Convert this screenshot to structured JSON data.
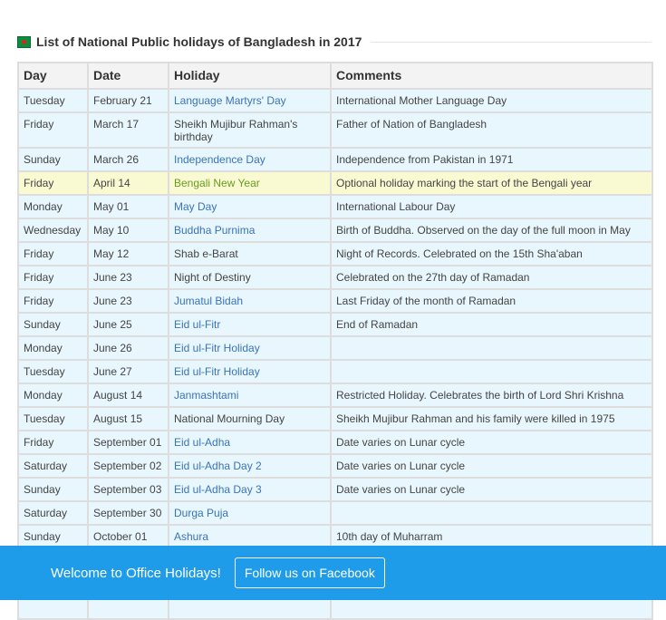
{
  "title": "List of National Public holidays of Bangladesh in 2017",
  "colors": {
    "link": "#3b73b9",
    "highlight_row": "#fafad2",
    "row_bg": "#e8f6fd",
    "banner": "#1e9be9"
  },
  "table": {
    "headers": [
      "Day",
      "Date",
      "Holiday",
      "Comments"
    ],
    "rows": [
      {
        "day": "Tuesday",
        "date": "February 21",
        "holiday": "Language Martyrs' Day",
        "link": true,
        "comment": "International Mother Language Day"
      },
      {
        "day": "Friday",
        "date": "March 17",
        "holiday": "Sheikh Mujibur Rahman's birthday",
        "link": false,
        "comment": "Father of Nation of Bangladesh"
      },
      {
        "day": "Sunday",
        "date": "March 26",
        "holiday": "Independence Day",
        "link": true,
        "comment": "Independence from Pakistan in 1971"
      },
      {
        "day": "Friday",
        "date": "April 14",
        "holiday": "Bengali New Year",
        "link": true,
        "highlight": true,
        "comment": "Optional holiday marking the start of the Bengali year"
      },
      {
        "day": "Monday",
        "date": "May 01",
        "holiday": "May Day",
        "link": true,
        "comment": "International Labour Day"
      },
      {
        "day": "Wednesday",
        "date": "May 10",
        "holiday": "Buddha Purnima",
        "link": true,
        "comment": "Birth of Buddha. Observed on the day of the full moon in May"
      },
      {
        "day": "Friday",
        "date": "May 12",
        "holiday": "Shab e-Barat",
        "link": false,
        "comment": "Night of Records. Celebrated on the 15th Sha'aban"
      },
      {
        "day": "Friday",
        "date": "June 23",
        "holiday": "Night of Destiny",
        "link": false,
        "comment": "Celebrated on the 27th day of Ramadan"
      },
      {
        "day": "Friday",
        "date": "June 23",
        "holiday": "Jumatul Bidah",
        "link": true,
        "comment": "Last Friday of the month of Ramadan"
      },
      {
        "day": "Sunday",
        "date": "June 25",
        "holiday": "Eid ul-Fitr",
        "link": true,
        "comment": "End of Ramadan"
      },
      {
        "day": "Monday",
        "date": "June 26",
        "holiday": "Eid ul-Fitr Holiday",
        "link": true,
        "comment": ""
      },
      {
        "day": "Tuesday",
        "date": "June 27",
        "holiday": "Eid ul-Fitr Holiday",
        "link": true,
        "comment": ""
      },
      {
        "day": "Monday",
        "date": "August 14",
        "holiday": "Janmashtami",
        "link": true,
        "comment": "Restricted Holiday. Celebrates the birth of Lord Shri Krishna"
      },
      {
        "day": "Tuesday",
        "date": "August 15",
        "holiday": "National Mourning Day",
        "link": false,
        "comment": "Sheikh Mujibur Rahman and his family were killed in 1975"
      },
      {
        "day": "Friday",
        "date": "September 01",
        "holiday": "Eid ul-Adha",
        "link": true,
        "comment": "Date varies on Lunar cycle"
      },
      {
        "day": "Saturday",
        "date": "September 02",
        "holiday": "Eid ul-Adha Day 2",
        "link": true,
        "comment": "Date varies on Lunar cycle"
      },
      {
        "day": "Sunday",
        "date": "September 03",
        "holiday": "Eid ul-Adha Day 3",
        "link": true,
        "comment": "Date varies on Lunar cycle"
      },
      {
        "day": "Saturday",
        "date": "September 30",
        "holiday": "Durga Puja",
        "link": true,
        "comment": ""
      },
      {
        "day": "Sunday",
        "date": "October 01",
        "holiday": "Ashura",
        "link": true,
        "comment": "10th day of Muharram"
      },
      {
        "day": "",
        "date": "",
        "holiday": "",
        "link": false,
        "comment": ""
      },
      {
        "day": "",
        "date": "",
        "holiday": "",
        "link": false,
        "comment": ""
      },
      {
        "day": "",
        "date": "",
        "holiday": "",
        "link": false,
        "comment": ""
      }
    ]
  },
  "banner": {
    "text": "Welcome to Office Holidays!",
    "button_label": "Follow us on Facebook"
  }
}
